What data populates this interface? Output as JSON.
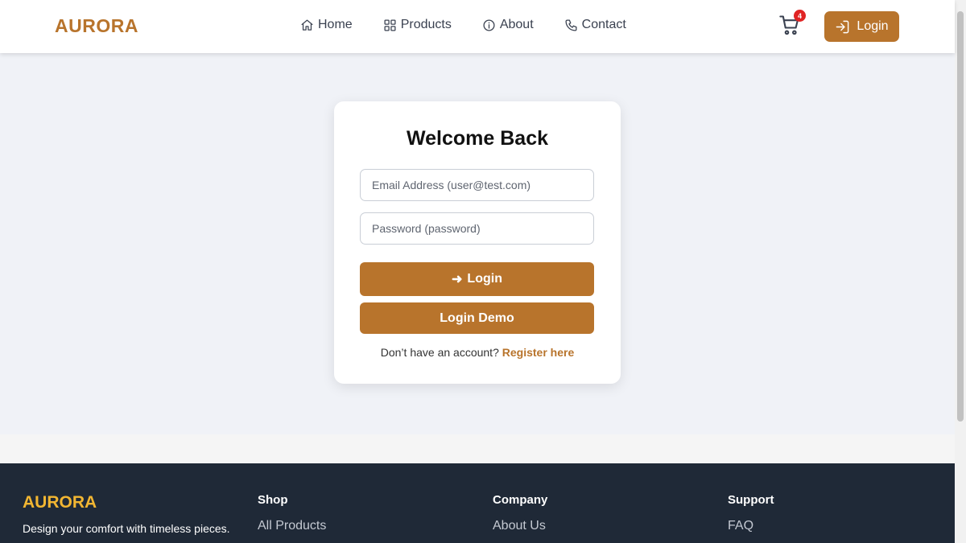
{
  "header": {
    "logo": "AURORA",
    "nav": [
      {
        "label": "Home",
        "icon": "home-icon"
      },
      {
        "label": "Products",
        "icon": "grid-icon"
      },
      {
        "label": "About",
        "icon": "info-icon"
      },
      {
        "label": "Contact",
        "icon": "phone-icon"
      }
    ],
    "cart_count": "4",
    "login_label": "Login"
  },
  "login_card": {
    "title": "Welcome Back",
    "email_placeholder": "Email Address (user@test.com)",
    "email_value": "",
    "password_placeholder": "Password (password)",
    "password_value": "",
    "login_button_arrow": "➜",
    "login_button": "Login",
    "demo_button": "Login Demo",
    "register_prompt": "Don’t have an account?",
    "register_link": "Register here"
  },
  "footer": {
    "logo": "AURORA",
    "tagline": "Design your comfort with timeless pieces.",
    "columns": [
      {
        "heading": "Shop",
        "links": [
          "All Products"
        ]
      },
      {
        "heading": "Company",
        "links": [
          "About Us"
        ]
      },
      {
        "heading": "Support",
        "links": [
          "FAQ"
        ]
      }
    ]
  },
  "colors": {
    "accent": "#b8742c",
    "footer_bg": "#1f2937",
    "footer_logo": "#f2b632",
    "badge": "#e02424",
    "page_bg": "#f0f2f7"
  }
}
